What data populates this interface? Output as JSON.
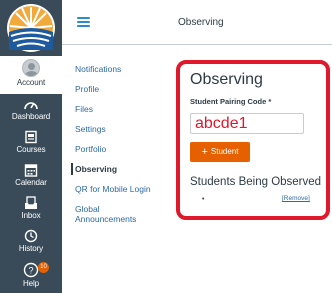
{
  "colors": {
    "nav_bg": "#394b58",
    "accent": "#e66000",
    "link": "#2d6aa6",
    "highlight": "#e0182b"
  },
  "global_nav": {
    "items": [
      {
        "label": "Account",
        "icon": "avatar"
      },
      {
        "label": "Dashboard",
        "icon": "dashboard-icon"
      },
      {
        "label": "Courses",
        "icon": "courses-icon"
      },
      {
        "label": "Calendar",
        "icon": "calendar-icon"
      },
      {
        "label": "Inbox",
        "icon": "inbox-icon"
      },
      {
        "label": "History",
        "icon": "history-icon"
      },
      {
        "label": "Help",
        "icon": "help-icon",
        "badge": "10"
      }
    ]
  },
  "header": {
    "title": "Observing",
    "menu_icon": "hamburger-icon"
  },
  "settings_nav": {
    "items": [
      {
        "label": "Notifications"
      },
      {
        "label": "Profile"
      },
      {
        "label": "Files"
      },
      {
        "label": "Settings"
      },
      {
        "label": "Portfolio"
      },
      {
        "label": "Observing",
        "current": true
      },
      {
        "label": "QR for Mobile Login"
      },
      {
        "label": "Global"
      },
      {
        "label": "Announcements"
      }
    ]
  },
  "observing": {
    "title": "Observing",
    "pairing_label": "Student Pairing Code *",
    "pairing_value": "abcde1",
    "add_button": "Student",
    "add_icon": "+",
    "observed_heading": "Students Being Observed",
    "bullet": "•",
    "remove_link": "[Remove]"
  }
}
